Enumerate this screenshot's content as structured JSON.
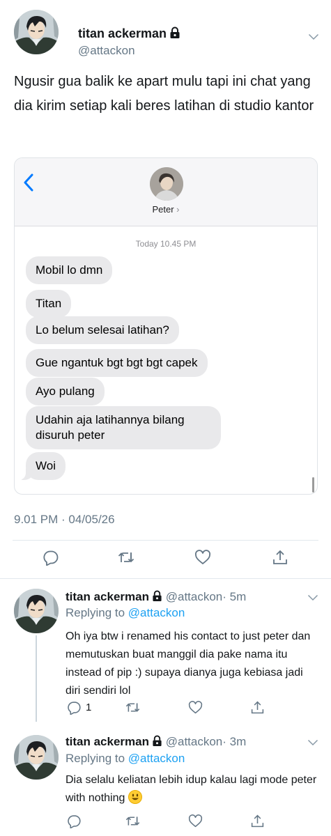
{
  "main_tweet": {
    "author_name": "titan ackerman",
    "handle": "@attackon",
    "text": "Ngusir gua balik ke apart mulu tapi ini chat yang dia kirim setiap kali beres latihan di studio kantor",
    "timestamp": "9.01 PM · 04/05/26"
  },
  "chat": {
    "contact_name": "Peter",
    "contact_chevron": "›",
    "time": "Today 10.45 PM",
    "messages": [
      "Mobil lo dmn",
      "Titan",
      "Lo belum selesai latihan?",
      "Gue ngantuk bgt bgt bgt capek",
      "Ayo pulang",
      "Udahin aja latihannya bilang disuruh peter",
      "Woi"
    ]
  },
  "replies": [
    {
      "author_name": "titan ackerman",
      "handle": "@attackon",
      "time": "· 5m",
      "replying_prefix": "Replying to",
      "replying_to": "@attackon",
      "text": "Oh iya btw i renamed his contact to just peter dan memutuskan buat manggil dia pake nama itu instead of pip :) supaya dianya juga kebiasa jadi diri sendiri lol",
      "reply_count": "1"
    },
    {
      "author_name": "titan ackerman",
      "handle": "@attackon",
      "time": "· 3m",
      "replying_prefix": "Replying to",
      "replying_to": "@attackon",
      "text": "Dia selalu keliatan lebih idup kalau lagi mode peter with nothing"
    }
  ],
  "colors": {
    "link": "#1da1f2",
    "muted": "#657786",
    "ios_blue": "#007aff",
    "bubble_gray": "#e9e9eb"
  },
  "icons": [
    "lock-icon",
    "chevron-down-icon",
    "back-chevron-icon",
    "reply-icon",
    "retweet-icon",
    "like-icon",
    "share-icon",
    "smiley-emoji-icon"
  ]
}
